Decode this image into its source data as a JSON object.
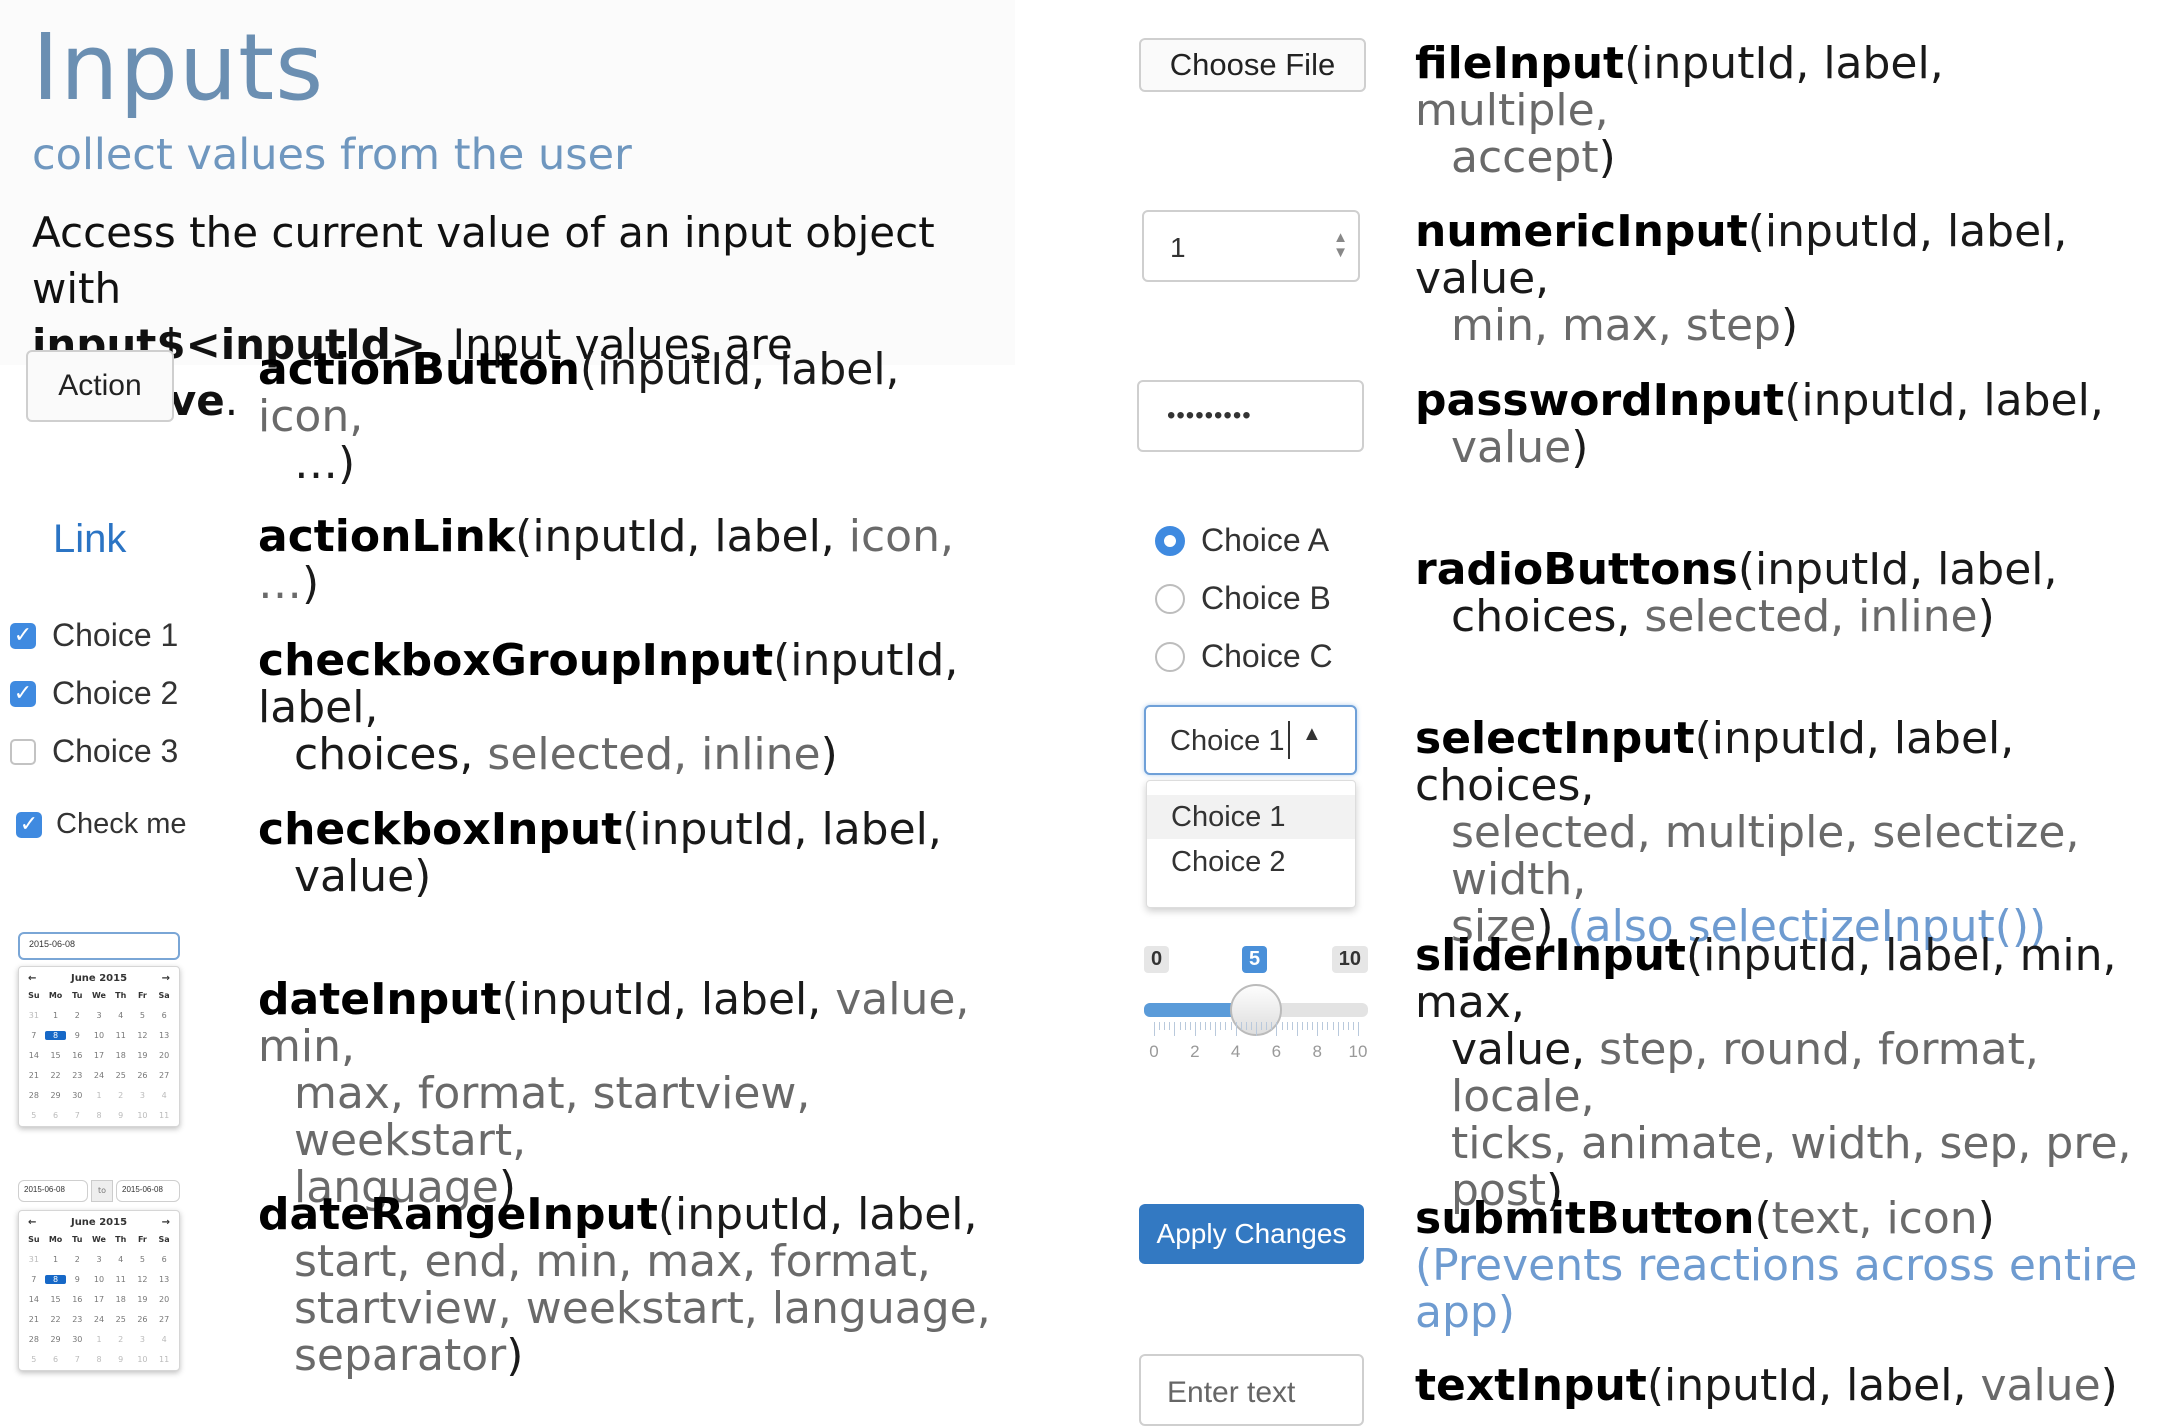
{
  "header": {
    "title": "Inputs",
    "subtitle": "collect values from the user",
    "intro_1": "Access the current value of an input object with",
    "intro_code": "input$<inputId>",
    "intro_2": ". Input values are ",
    "intro_bold": "reactive",
    "intro_3": "."
  },
  "widgets": {
    "action_button": "Action",
    "action_link": "Link",
    "checkbox_group": [
      {
        "label": "Choice 1",
        "checked": true
      },
      {
        "label": "Choice 2",
        "checked": true
      },
      {
        "label": "Choice 3",
        "checked": false
      }
    ],
    "checkbox": {
      "label": "Check me",
      "checked": true
    },
    "date_value": "2015-06-08",
    "date_range_start": "2015-06-08",
    "date_range_sep": "to",
    "date_range_end": "2015-06-08",
    "calendar": {
      "month": "June 2015",
      "days": [
        "Su",
        "Mo",
        "Tu",
        "We",
        "Th",
        "Fr",
        "Sa"
      ],
      "weeks": [
        [
          "31",
          "1",
          "2",
          "3",
          "4",
          "5",
          "6"
        ],
        [
          "7",
          "8",
          "9",
          "10",
          "11",
          "12",
          "13"
        ],
        [
          "14",
          "15",
          "16",
          "17",
          "18",
          "19",
          "20"
        ],
        [
          "21",
          "22",
          "23",
          "24",
          "25",
          "26",
          "27"
        ],
        [
          "28",
          "29",
          "30",
          "1",
          "2",
          "3",
          "4"
        ],
        [
          "5",
          "6",
          "7",
          "8",
          "9",
          "10",
          "11"
        ]
      ],
      "selected": "8"
    },
    "file_button": "Choose File",
    "numeric_value": "1",
    "password_value": "•••••••••",
    "radio": [
      {
        "label": "Choice A",
        "selected": true
      },
      {
        "label": "Choice B",
        "selected": false
      },
      {
        "label": "Choice C",
        "selected": false
      }
    ],
    "select_value": "Choice 1",
    "select_options": [
      "Choice 1",
      "Choice 2"
    ],
    "slider": {
      "min": "0",
      "max": "10",
      "value": "5",
      "value_fraction": 0.5,
      "ticks": [
        "0",
        "2",
        "4",
        "6",
        "8",
        "10"
      ]
    },
    "submit_button": "Apply Changes",
    "text_placeholder": "Enter text"
  },
  "functions": {
    "actionButton": {
      "name": "actionButton",
      "a": "(inputId, label, ",
      "opt": "icon,",
      "b": "…)"
    },
    "actionLink": {
      "name": "actionLink",
      "a": "(inputId, label, ",
      "opt": "icon, …",
      "b": ")"
    },
    "checkboxGroupInput": {
      "name": "checkboxGroupInput",
      "a": "(inputId, label,",
      "b": "choices, ",
      "opt": "selected, inline",
      "c": ")"
    },
    "checkboxInput": {
      "name": "checkboxInput",
      "a": "(inputId, label,",
      "b": "value)"
    },
    "dateInput": {
      "name": "dateInput",
      "a": "(inputId, label, ",
      "opt1": "value, min,",
      "opt2": "max, format, startview, weekstart,",
      "opt3": "language",
      "c": ")"
    },
    "dateRangeInput": {
      "name": "dateRangeInput",
      "a": "(inputId, label,",
      "opt1": "start, end, min, max, format,",
      "opt2": "startview, weekstart, language,",
      "opt3": "separator",
      "c": ")"
    },
    "fileInput": {
      "name": "fileInput",
      "a": "(inputId, label, ",
      "opt1": "multiple,",
      "opt2": "accept",
      "c": ")"
    },
    "numericInput": {
      "name": "numericInput",
      "a": "(inputId, label, value,",
      "opt": "min, max, step",
      "c": ")"
    },
    "passwordInput": {
      "name": "passwordInput",
      "a": "(inputId, label,",
      "opt": "value",
      "c": ")"
    },
    "radioButtons": {
      "name": "radioButtons",
      "a": "(inputId, label,",
      "b": "choices, ",
      "opt": "selected, inline",
      "c": ")"
    },
    "selectInput": {
      "name": "selectInput",
      "a": "(inputId, label, choices,",
      "opt1": "selected, multiple, selectize, width,",
      "opt2": "size",
      "c": ") ",
      "note": "(also selectizeInput())"
    },
    "sliderInput": {
      "name": "sliderInput",
      "a": "(inputId, label, min, max,",
      "b": "value, ",
      "opt1": "step, round, format, locale,",
      "opt2": "ticks, animate, width, sep, pre,",
      "opt3": "post",
      "c": ")"
    },
    "submitButton": {
      "name": "submitButton",
      "a": "(",
      "opt": "text, icon",
      "c": ")",
      "note": "(Prevents reactions across entire app)"
    },
    "textInput": {
      "name": "textInput",
      "a": "(inputId, label, ",
      "opt": "value",
      "c": ")"
    }
  }
}
